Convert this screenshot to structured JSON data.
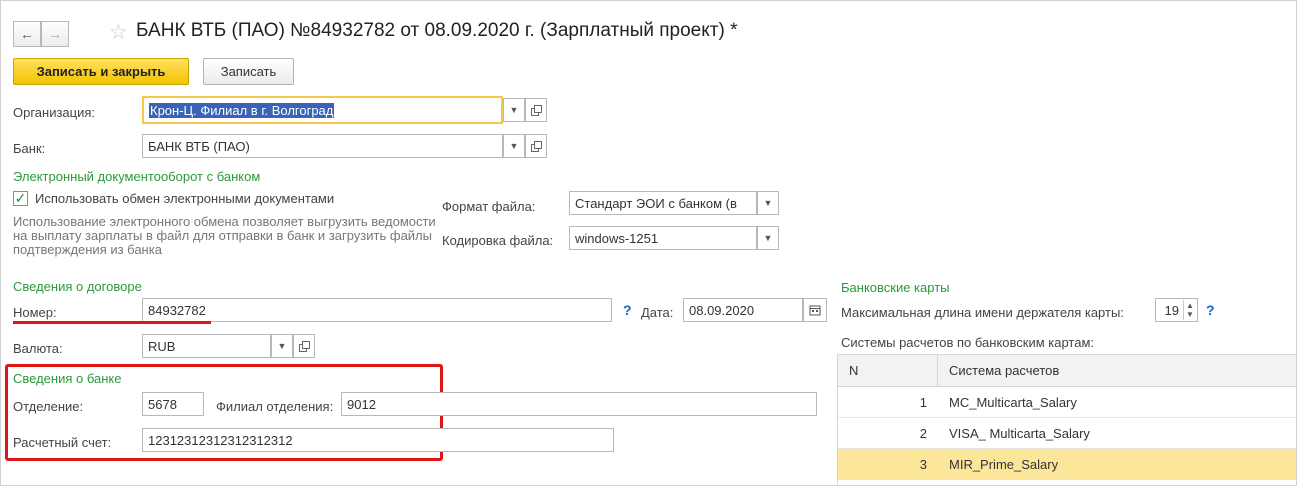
{
  "header": {
    "title": "БАНК ВТБ (ПАО) №84932782 от 08.09.2020 г. (Зарплатный проект) *",
    "back_icon": "←",
    "forward_icon": "→",
    "star_icon": "☆"
  },
  "toolbar": {
    "save_close_label": "Записать и закрыть",
    "save_label": "Записать"
  },
  "organization": {
    "label": "Организация:",
    "value": "Крон-Ц. Филиал в г. Волгоград"
  },
  "bank": {
    "label": "Банк:",
    "value": "БАНК ВТБ (ПАО)"
  },
  "edo": {
    "section_title": "Электронный документооборот с банком",
    "use_exchange_label": "Использовать обмен электронными документами",
    "use_exchange_checked": true,
    "note": "Использование электронного обмена позволяет выгрузить ведомости на выплату зарплаты в файл для отправки в банк и загрузить файлы подтверждения из банка",
    "file_format_label": "Формат файла:",
    "file_format_value": "Стандарт ЭОИ с банком (в",
    "encoding_label": "Кодировка файла:",
    "encoding_value": "windows-1251"
  },
  "contract": {
    "section_title": "Сведения о договоре",
    "number_label": "Номер:",
    "number_value": "84932782",
    "date_label": "Дата:",
    "date_value": "08.09.2020",
    "currency_label": "Валюта:",
    "currency_value": "RUB",
    "help": "?"
  },
  "bank_details": {
    "section_title": "Сведения о банке",
    "branch_label": "Отделение:",
    "branch_value": "5678",
    "sub_branch_label": "Филиал отделения:",
    "sub_branch_value": "9012",
    "account_label": "Расчетный счет:",
    "account_value": "12312312312312312312"
  },
  "cards": {
    "section_title": "Банковские карты",
    "max_name_label": "Максимальная длина имени держателя карты:",
    "max_name_value": "19",
    "systems_label": "Системы расчетов по банковским картам:",
    "help": "?",
    "columns": [
      "N",
      "Система расчетов"
    ],
    "rows": [
      {
        "n": "1",
        "system": "MC_Multicarta_Salary"
      },
      {
        "n": "2",
        "system": "VISA_ Multicarta_Salary"
      },
      {
        "n": "3",
        "system": "MIR_Prime_Salary"
      }
    ],
    "selected_row_color": "#fbe69a"
  },
  "colors": {
    "accent_yellow": "#f3c300",
    "section_green": "#2a9a3a",
    "highlight_red": "#e01616",
    "help_blue": "#1565c0"
  }
}
